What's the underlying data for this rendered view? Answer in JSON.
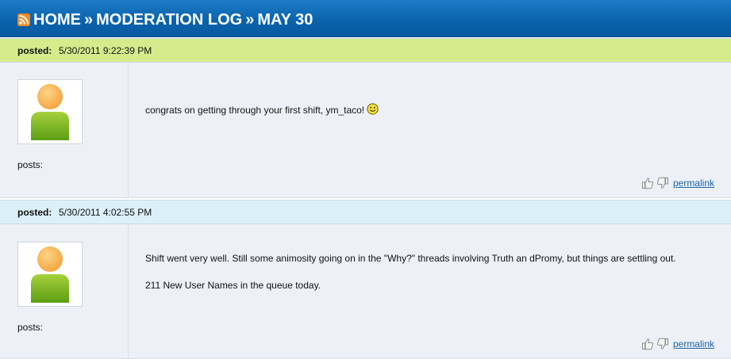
{
  "header": {
    "crumbs": [
      "HOME",
      "MODERATION LOG",
      "MAY 30"
    ],
    "separator": "»",
    "rss_icon": "rss-icon"
  },
  "posts": [
    {
      "posted_label": "posted:",
      "date": "5/30/2011 9:22:39 PM",
      "posts_label": "posts:",
      "message": [
        "congrats on getting through your first shift, ym_taco!"
      ],
      "has_smiley": true,
      "permalink": "permalink"
    },
    {
      "posted_label": "posted:",
      "date": "5/30/2011 4:02:55 PM",
      "posts_label": "posts:",
      "message": [
        "Shift went very well. Still some animosity going on in the \"Why?\" threads involving Truth an dPromy, but things are settling out.",
        "211 New User Names in the queue today."
      ],
      "permalink": "permalink"
    }
  ],
  "colors": {
    "header_blue": "#0a63ad",
    "post1_header": "#d5ec8c",
    "post2_header": "#dbf0f8",
    "body_bg": "#edf1f7",
    "link": "#1a62a8"
  }
}
